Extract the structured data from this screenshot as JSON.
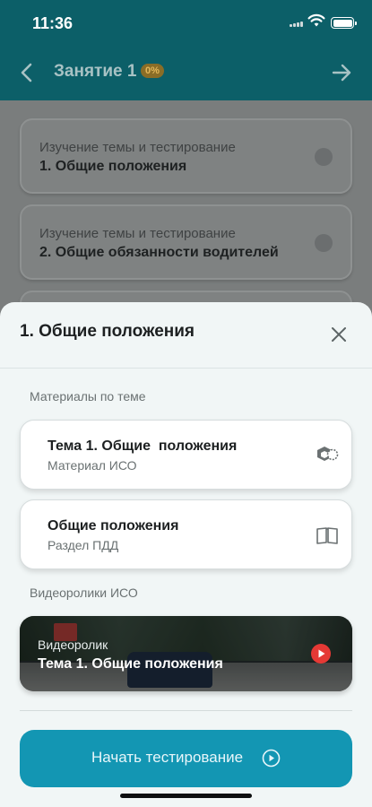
{
  "status_bar": {
    "time": "11:36"
  },
  "header": {
    "title": "Занятие 1",
    "progress_badge": "0%"
  },
  "lesson_cards": [
    {
      "subtitle": "Изучение темы и тестирование",
      "title": "1. Общие положения"
    },
    {
      "subtitle": "Изучение темы и тестирование",
      "title": "2. Общие обязанности водителей"
    }
  ],
  "sheet": {
    "title": "1. Общие положения",
    "materials_label": "Материалы по теме",
    "materials": [
      {
        "title": "Тема 1. Общие  положения",
        "subtitle": "Материал ИСО",
        "icon": "iso-material-icon"
      },
      {
        "title": "Общие положения",
        "subtitle": "Раздел ПДД",
        "icon": "book-icon"
      }
    ],
    "videos_label": "Видеоролики ИСО",
    "video": {
      "subtitle": "Видеоролик",
      "title": "Тема 1. Общие положения"
    },
    "start_button": "Начать тестирование"
  },
  "colors": {
    "header_bg": "#0c5f68",
    "sheet_bg": "#f1f6f6",
    "primary_button": "#1396b3",
    "badge": "#8a6d27",
    "play_red": "#e53935"
  }
}
